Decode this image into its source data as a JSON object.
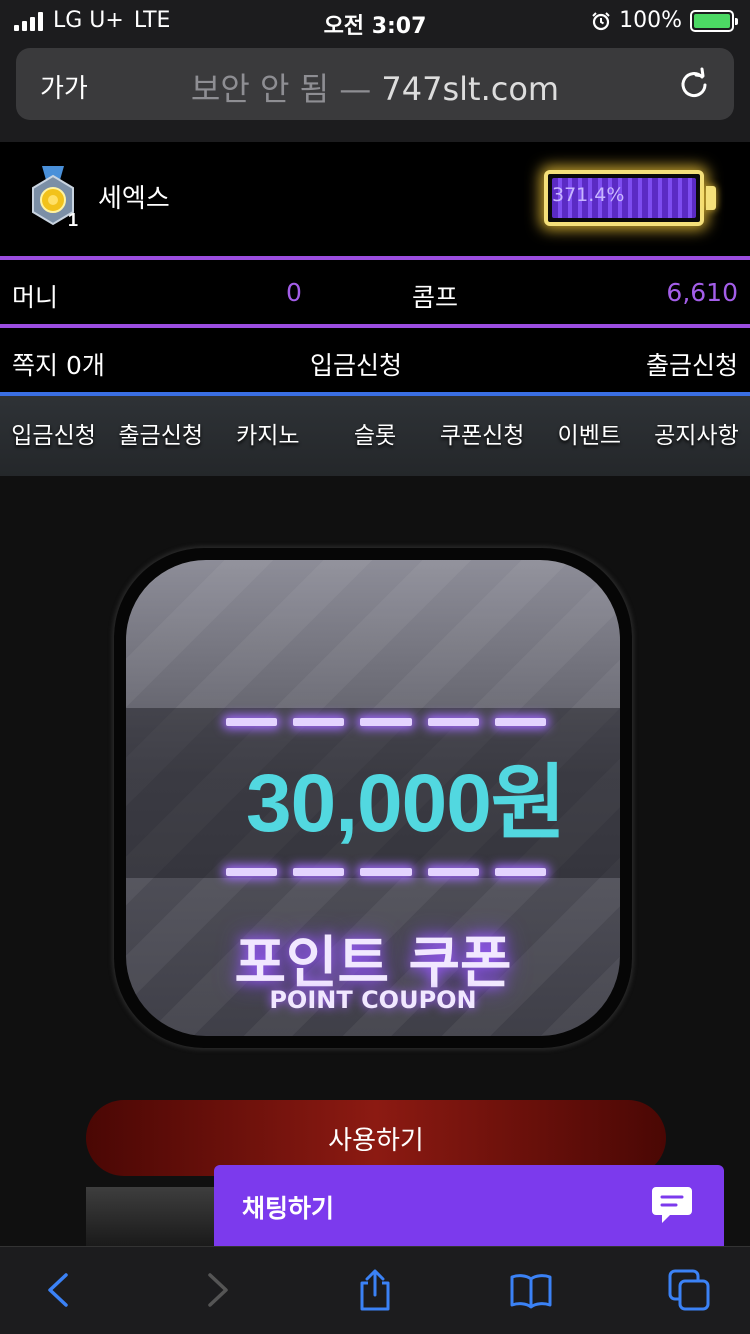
{
  "status_bar": {
    "carrier": "LG U+",
    "network": "LTE",
    "time": "오전 3:07",
    "battery_percent": "100%"
  },
  "browser": {
    "text_size_label": "가가",
    "insecure_label": "보안 안 됨",
    "separator": "—",
    "domain": "747slt.com"
  },
  "user": {
    "name": "세엑스",
    "medal_level": "1",
    "level_progress_label": "371.4%",
    "level_progress_fill": 1.0
  },
  "balance": {
    "money_label": "머니",
    "money_value": "0",
    "comp_label": "콤프",
    "comp_value": "6,610"
  },
  "quick_links": {
    "messages": "쪽지 0개",
    "deposit": "입금신청",
    "withdraw": "출금신청"
  },
  "menu": {
    "items": [
      "입금신청",
      "출금신청",
      "카지노",
      "슬롯",
      "쿠폰신청",
      "이벤트",
      "공지사항"
    ]
  },
  "coupon": {
    "amount": "30,000원",
    "title_ko": "포인트 쿠폰",
    "title_en": "POINT COUPON",
    "use_button": "사용하기"
  },
  "chat": {
    "label": "채팅하기"
  },
  "colors": {
    "accent_purple": "#9b4de0",
    "accent_blue": "#3a6fe3",
    "coupon_amount": "#52d8e0",
    "chat_bg": "#7c3aed"
  }
}
